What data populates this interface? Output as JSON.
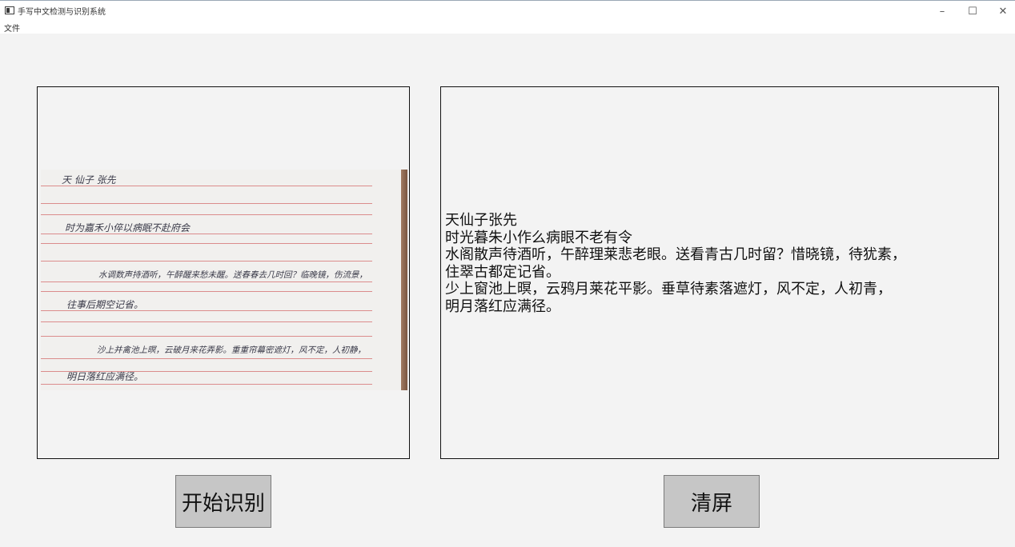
{
  "window": {
    "title": "手写中文检测与识别系统",
    "controls": {
      "minimize": "–",
      "maximize": "☐",
      "close": "✕"
    }
  },
  "menu": {
    "file_label": "文件"
  },
  "image_panel": {
    "handwritten_lines": [
      "天 仙子 张先",
      "时为嘉禾小倅以病眠不赴府会",
      "水调数声持酒听，午醉醒来愁未醒。送春春去几时回？临晚镜，伤流景，",
      "往事后期空记省。",
      "沙上并禽池上暝，云破月来花弄影。重重帘幕密遮灯，风不定，人初静，",
      "明日落红应满径。"
    ]
  },
  "result_panel": {
    "lines": [
      "天仙子张先",
      "时光暮朱小作么病眼不老有令",
      "水阁散声待酒听，午醉理莱悲老眼。送看青古几时留？惜晓镜，待犹素，",
      "住翠古都定记省。",
      "少上窗池上暝，云鸦月莱花平影。垂草待素落遮灯，风不定，人初青，",
      "明月落红应满径。"
    ]
  },
  "buttons": {
    "start_label": "开始识别",
    "clear_label": "清屏"
  },
  "colors": {
    "background": "#f3f3f3",
    "button_bg": "#c6c6c6",
    "ruled_line": "#d77a7a"
  }
}
